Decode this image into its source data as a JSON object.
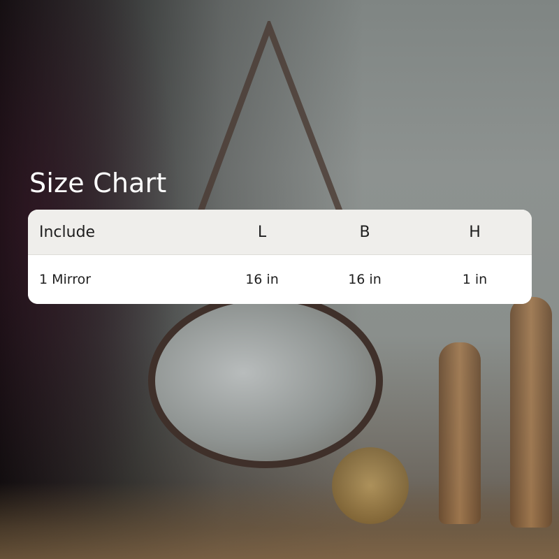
{
  "title": "Size Chart",
  "table": {
    "headers": [
      "Include",
      "L",
      "B",
      "H"
    ],
    "rows": [
      [
        "1 Mirror",
        "16 in",
        "16 in",
        "1 in"
      ]
    ]
  },
  "colors": {
    "title_text": "#ffffff",
    "header_bg": "#efeeeb",
    "body_bg": "#ffffff",
    "cell_text": "#1e1e1e"
  }
}
